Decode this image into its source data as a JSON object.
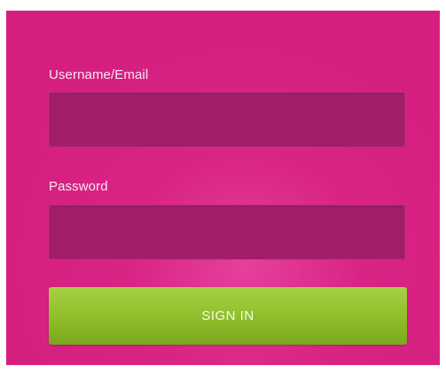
{
  "login_form": {
    "username_label": "Username/Email",
    "username_value": "",
    "password_label": "Password",
    "password_value": "",
    "signin_label": "SIGN IN"
  },
  "colors": {
    "panel_background": "#d51f80",
    "field_background": "#a01f68",
    "button_background": "#8fbe2a",
    "label_text": "#fbe6f1"
  }
}
